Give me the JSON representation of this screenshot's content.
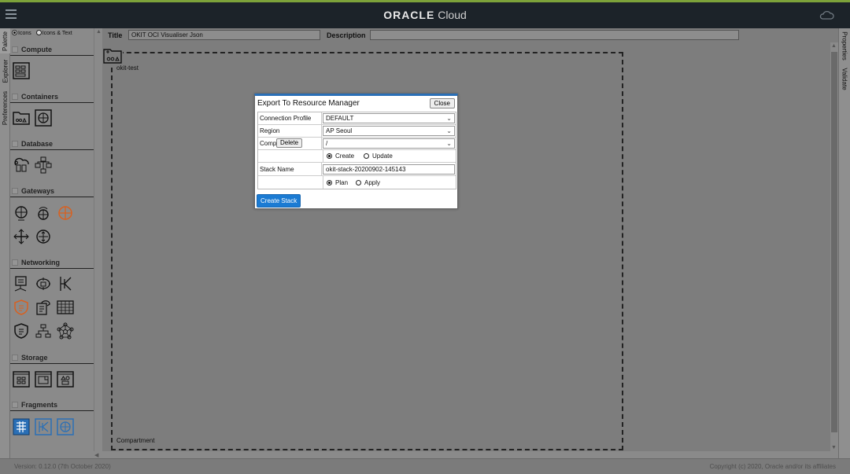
{
  "topbar": {
    "brand_bold": "ORACLE",
    "brand_light": "Cloud"
  },
  "left_tabs": [
    "Palette",
    "Explorer",
    "Preferences"
  ],
  "right_tabs": [
    "Properties",
    "Validate"
  ],
  "palette": {
    "view_options": [
      {
        "label": "Icons",
        "selected": true
      },
      {
        "label": "Icons & Text",
        "selected": false
      }
    ],
    "sections": [
      {
        "title": "Compute",
        "icons": [
          "instance-icon"
        ]
      },
      {
        "title": "Containers",
        "icons": [
          "compartment-icon",
          "cluster-icon"
        ]
      },
      {
        "title": "Database",
        "icons": [
          "autonomous-database-icon",
          "database-system-icon"
        ]
      },
      {
        "title": "Gateways",
        "icons": [
          "internet-gateway-icon",
          "nat-gateway-icon",
          "service-gateway-icon",
          "drg-icon",
          "local-peering-gateway-icon"
        ]
      },
      {
        "title": "Networking",
        "icons": [
          "load-balancer-icon",
          "network-security-group-icon",
          "route-table-icon",
          "security-list-icon",
          "dhcp-options-icon",
          "subnet-icon",
          "firewall-icon",
          "network-icon",
          "virtual-cloud-network-icon"
        ]
      },
      {
        "title": "Storage",
        "icons": [
          "block-storage-icon",
          "file-storage-icon",
          "object-storage-icon"
        ]
      },
      {
        "title": "Fragments",
        "icons": [
          "fragment-grid-icon",
          "fragment-route-icon",
          "fragment-gateway-icon"
        ]
      }
    ]
  },
  "header": {
    "title_label": "Title",
    "title_value": "OKIT OCI Visualiser Json",
    "description_label": "Description",
    "description_value": ""
  },
  "canvas": {
    "compartment_name": "okit-test",
    "compartment_label": "Compartment"
  },
  "dialog": {
    "title": "Export To Resource Manager",
    "close_label": "Close",
    "connection_profile_label": "Connection Profile",
    "connection_profile_value": "DEFAULT",
    "region_label": "Region",
    "region_value": "AP Seoul",
    "compartment_label": "Comp",
    "delete_label": "Delete",
    "compartment_value": "/",
    "mode_options": [
      {
        "label": "Create",
        "selected": true
      },
      {
        "label": "Update",
        "selected": false
      }
    ],
    "stack_name_label": "Stack Name",
    "stack_name_value": "okit-stack-20200902-145143",
    "action_options": [
      {
        "label": "Plan",
        "selected": true
      },
      {
        "label": "Apply",
        "selected": false
      }
    ],
    "create_stack_label": "Create Stack"
  },
  "footer": {
    "version": "Version: 0.12.0 (7th October 2020)",
    "copyright": "Copyright (c) 2020, Oracle and/or its affiliates"
  },
  "colors": {
    "accent_blue": "#1b7bd3",
    "orange_icon": "#d9601f",
    "fragment_blue": "#2a6fb6",
    "topbar": "#1c2329"
  }
}
